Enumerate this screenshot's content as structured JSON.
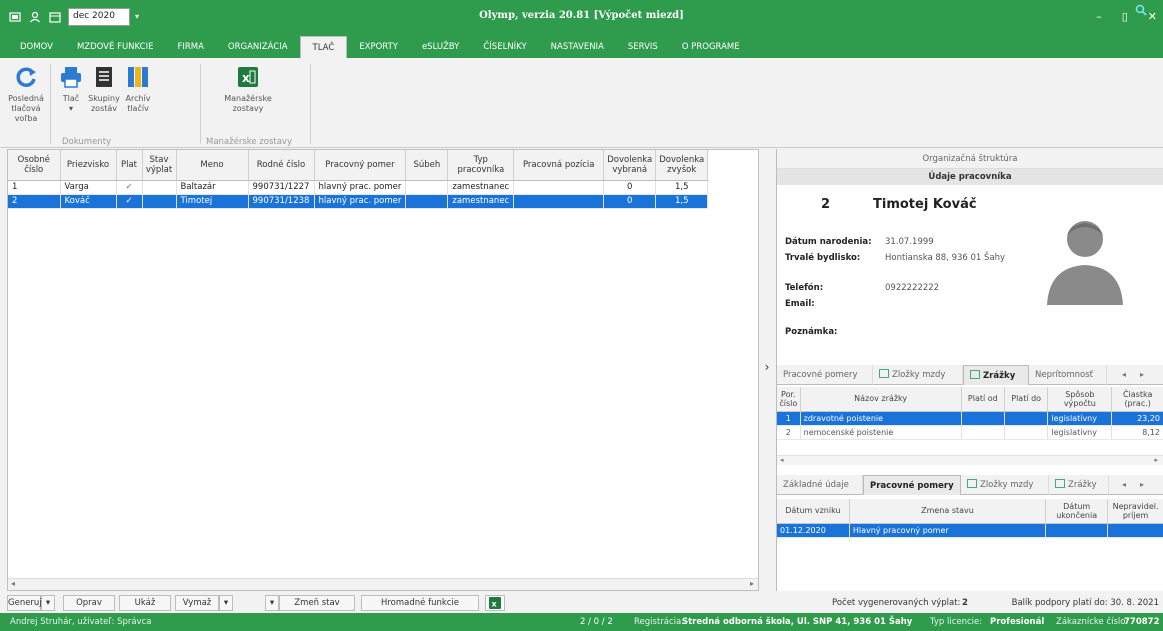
{
  "window": {
    "title": "Olymp, verzia 20.81 [Výpočet miezd]",
    "period": "dec 2020"
  },
  "menu": [
    {
      "label": "DOMOV"
    },
    {
      "label": "MZDOVÉ FUNKCIE"
    },
    {
      "label": "FIRMA"
    },
    {
      "label": "ORGANIZÁCIA"
    },
    {
      "label": "TLAČ",
      "active": true
    },
    {
      "label": "EXPORTY"
    },
    {
      "label": "eSLUŽBY"
    },
    {
      "label": "ČÍSELNÍKY"
    },
    {
      "label": "NASTAVENIA"
    },
    {
      "label": "SERVIS"
    },
    {
      "label": "O PROGRAME"
    }
  ],
  "ribbon": {
    "last_print_l1": "Posledná",
    "last_print_l2": "tlačová voľba",
    "print_l1": "Tlač",
    "print_l2": "▾",
    "groups_l1": "Skupiny",
    "groups_l2": "zostáv",
    "archive_l1": "Archív",
    "archive_l2": "tlačív",
    "mgmt_l1": "Manažérske",
    "mgmt_l2": "zostavy",
    "group_documents": "Dokumenty",
    "group_mgmt": "Manažérske zostavy"
  },
  "grid": {
    "headers": {
      "osobne": "Osobné číslo",
      "priezvisko": "Priezvisko",
      "plat": "Plat",
      "stav": "Stav výplat",
      "meno": "Meno",
      "rodne": "Rodné číslo",
      "pomer": "Pracovný pomer",
      "subeh": "Súbeh",
      "typ": "Typ pracovníka",
      "pozicia": "Pracovná pozícia",
      "dov_vybrana": "Dovolenka vybraná",
      "dov_zvysok": "Dovolenka zvyšok"
    },
    "rows": [
      {
        "osobne": "1",
        "priezvisko": "Varga",
        "plat": "✓",
        "stav": "",
        "meno": "Baltazár",
        "rodne": "990731/1227",
        "pomer": "hlavný prac. pomer",
        "subeh": "",
        "typ": "zamestnanec",
        "pozicia": "",
        "dov_vybrana": "0",
        "dov_zvysok": "1,5"
      },
      {
        "osobne": "2",
        "priezvisko": "Kováč",
        "plat": "✓",
        "stav": "",
        "meno": "Timotej",
        "rodne": "990731/1238",
        "pomer": "hlavný prac. pomer",
        "subeh": "",
        "typ": "zamestnanec",
        "pozicia": "",
        "dov_vybrana": "0",
        "dov_zvysok": "1,5"
      }
    ]
  },
  "toolbar": {
    "generuj": "Generuj",
    "oprav": "Oprav",
    "ukaz": "Ukáž",
    "vymaz": "Vymaž",
    "zmen_stav": "Zmeň stav",
    "hromadne": "Hromadné funkcie"
  },
  "detail": {
    "org_structure": "Organizačná štruktúra",
    "header": "Údaje pracovníka",
    "number": "2",
    "name": "Timotej Kováč",
    "birth_label": "Dátum narodenia:",
    "birth_value": "31.07.1999",
    "address_label": "Trvalé bydlisko:",
    "address_value": "Hontianska 88, 936 01 Šahy",
    "phone_label": "Telefón:",
    "phone_value": "0922222222",
    "email_label": "Email:",
    "note_label": "Poznámka:"
  },
  "tabs1": [
    "Pracovné pomery",
    "Zložky mzdy",
    "Zrážky",
    "Neprítomnosť"
  ],
  "deductions": {
    "headers": {
      "por": "Por. číslo",
      "nazov": "Názov zrážky",
      "od": "Platí od",
      "do": "Platí do",
      "sposob": "Spôsob výpočtu",
      "suma": "Čiastka (prac.)"
    },
    "rows": [
      {
        "por": "1",
        "nazov": "zdravotné poistenie",
        "od": "",
        "do": "",
        "sposob": "legislatívny",
        "suma": "23,20"
      },
      {
        "por": "2",
        "nazov": "nemocenské poistenie",
        "od": "",
        "do": "",
        "sposob": "legislatívny",
        "suma": "8,12"
      }
    ]
  },
  "tabs2": [
    "Základné údaje",
    "Pracovné pomery",
    "Zložky mzdy",
    "Zrážky"
  ],
  "employment": {
    "headers": {
      "vznik": "Dátum vzniku",
      "zmena": "Zmena stavu",
      "ukoncenie": "Dátum ukončenia",
      "neprav": "Nepravidel. príjem"
    },
    "rows": [
      {
        "vznik": "01.12.2020",
        "zmena": "Hlavný pracovný pomer",
        "ukoncenie": "",
        "neprav": ""
      }
    ]
  },
  "summary": {
    "count_label": "Počet vygenerovaných výplat:",
    "count": "2",
    "support": "Balík podpory platí do: 30. 8. 2021"
  },
  "status": {
    "user": "Andrej Struhár, užívateľ: Správca",
    "counter": "2 / 0 / 2",
    "reg_label": "Registrácia:",
    "reg_value": "Stredná odborná škola, Ul. SNP 41, 936 01 Šahy",
    "lic_label": "Typ licencie:",
    "lic_value": "Profesionál",
    "cust_label": "Zákaznícke číslo:",
    "cust_value": "770872"
  },
  "colors": {
    "brand_green": "#2f9b4c",
    "selection": "#1a73d9"
  }
}
